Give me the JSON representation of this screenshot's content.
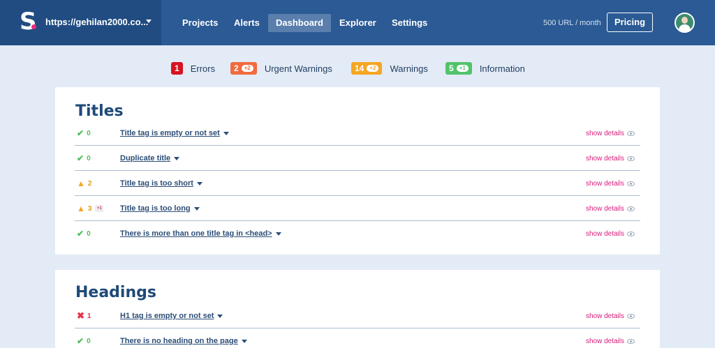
{
  "header": {
    "site_url": "https://gehilan2000.co...",
    "nav": [
      "Projects",
      "Alerts",
      "Dashboard",
      "Explorer",
      "Settings"
    ],
    "quota": "500 URL / month",
    "pricing": "Pricing"
  },
  "summary": [
    {
      "count": "1",
      "delta": "",
      "label": "Errors",
      "color": "#d7141f"
    },
    {
      "count": "2",
      "delta": "+2",
      "label": "Urgent Warnings",
      "color": "#f06b3f"
    },
    {
      "count": "14",
      "delta": "+2",
      "label": "Warnings",
      "color": "#f5a623"
    },
    {
      "count": "5",
      "delta": "+1",
      "label": "Information",
      "color": "#52c36a"
    }
  ],
  "sections": [
    {
      "title": "Titles",
      "rows": [
        {
          "icon": "check-icon",
          "count": "0",
          "delta": "",
          "label": "Title tag is empty or not set"
        },
        {
          "icon": "check-icon",
          "count": "0",
          "delta": "",
          "label": "Duplicate title"
        },
        {
          "icon": "warning-icon",
          "count": "2",
          "delta": "",
          "label": "Title tag is too short"
        },
        {
          "icon": "warning-icon",
          "count": "3",
          "delta": "+1",
          "label": "Title tag is too long"
        },
        {
          "icon": "check-icon",
          "count": "0",
          "delta": "",
          "label": "There is more than one title tag in <head>"
        }
      ]
    },
    {
      "title": "Headings",
      "rows": [
        {
          "icon": "cross-icon",
          "count": "1",
          "delta": "",
          "label": "H1 tag is empty or not set"
        },
        {
          "icon": "check-icon",
          "count": "0",
          "delta": "",
          "label": "There is no heading on the page"
        }
      ]
    }
  ],
  "show_details": "show details"
}
